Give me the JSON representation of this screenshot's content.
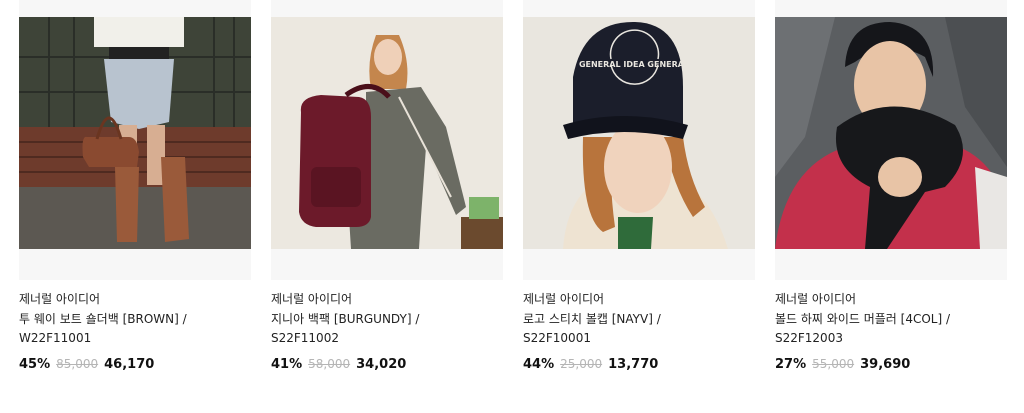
{
  "products": [
    {
      "brand": "제너럴 아이디어",
      "name_line1": "투 웨이 보트 숄더백 [BROWN] /",
      "name_line2": "W22F11001",
      "discount": "45%",
      "original_price": "85,000",
      "sale_price": "46,170",
      "image_icon": "woman-with-brown-shoulder-bag-photo"
    },
    {
      "brand": "제너럴 아이디어",
      "name_line1": "지니아 백팩 [BURGUNDY] /",
      "name_line2": "S22F11002",
      "discount": "41%",
      "original_price": "58,000",
      "sale_price": "34,020",
      "image_icon": "woman-with-burgundy-backpack-photo"
    },
    {
      "brand": "제너럴 아이디어",
      "name_line1": "로고 스티치 볼캡 [NAYV] /",
      "name_line2": "S22F10001",
      "discount": "44%",
      "original_price": "25,000",
      "sale_price": "13,770",
      "image_icon": "woman-in-navy-cap-photo"
    },
    {
      "brand": "제너럴 아이디어",
      "name_line1": "볼드 하찌 와이드 머플러 [4COL] /",
      "name_line2": "S22F12003",
      "discount": "27%",
      "original_price": "55,000",
      "sale_price": "39,690",
      "image_icon": "man-in-black-muffler-photo"
    }
  ],
  "cap_logo_text": "GENERAL IDEA GENERAL"
}
